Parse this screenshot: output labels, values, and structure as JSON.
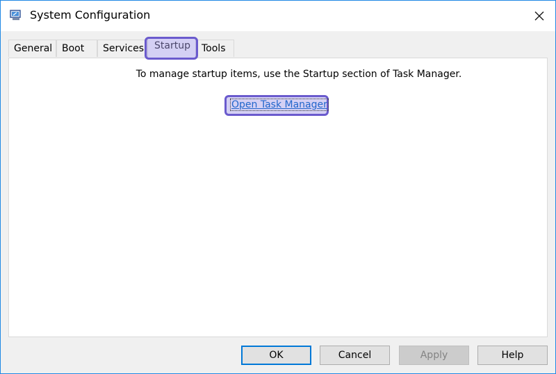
{
  "window": {
    "title": "System Configuration",
    "icon": "system-config-icon",
    "close_icon": "close-icon"
  },
  "tabs": [
    {
      "label": "General",
      "active": false
    },
    {
      "label": "Boot",
      "active": false
    },
    {
      "label": "Services",
      "active": false
    },
    {
      "label": "Startup",
      "active": true
    },
    {
      "label": "Tools",
      "active": false
    }
  ],
  "startup_panel": {
    "message": "To manage startup items, use the Startup section of Task Manager.",
    "link_label": "Open Task Manager"
  },
  "buttons": {
    "ok": "OK",
    "cancel": "Cancel",
    "apply": "Apply",
    "help": "Help"
  },
  "colors": {
    "accent": "#0078d7",
    "highlight": "#6a5acd",
    "link": "#2266cc"
  }
}
